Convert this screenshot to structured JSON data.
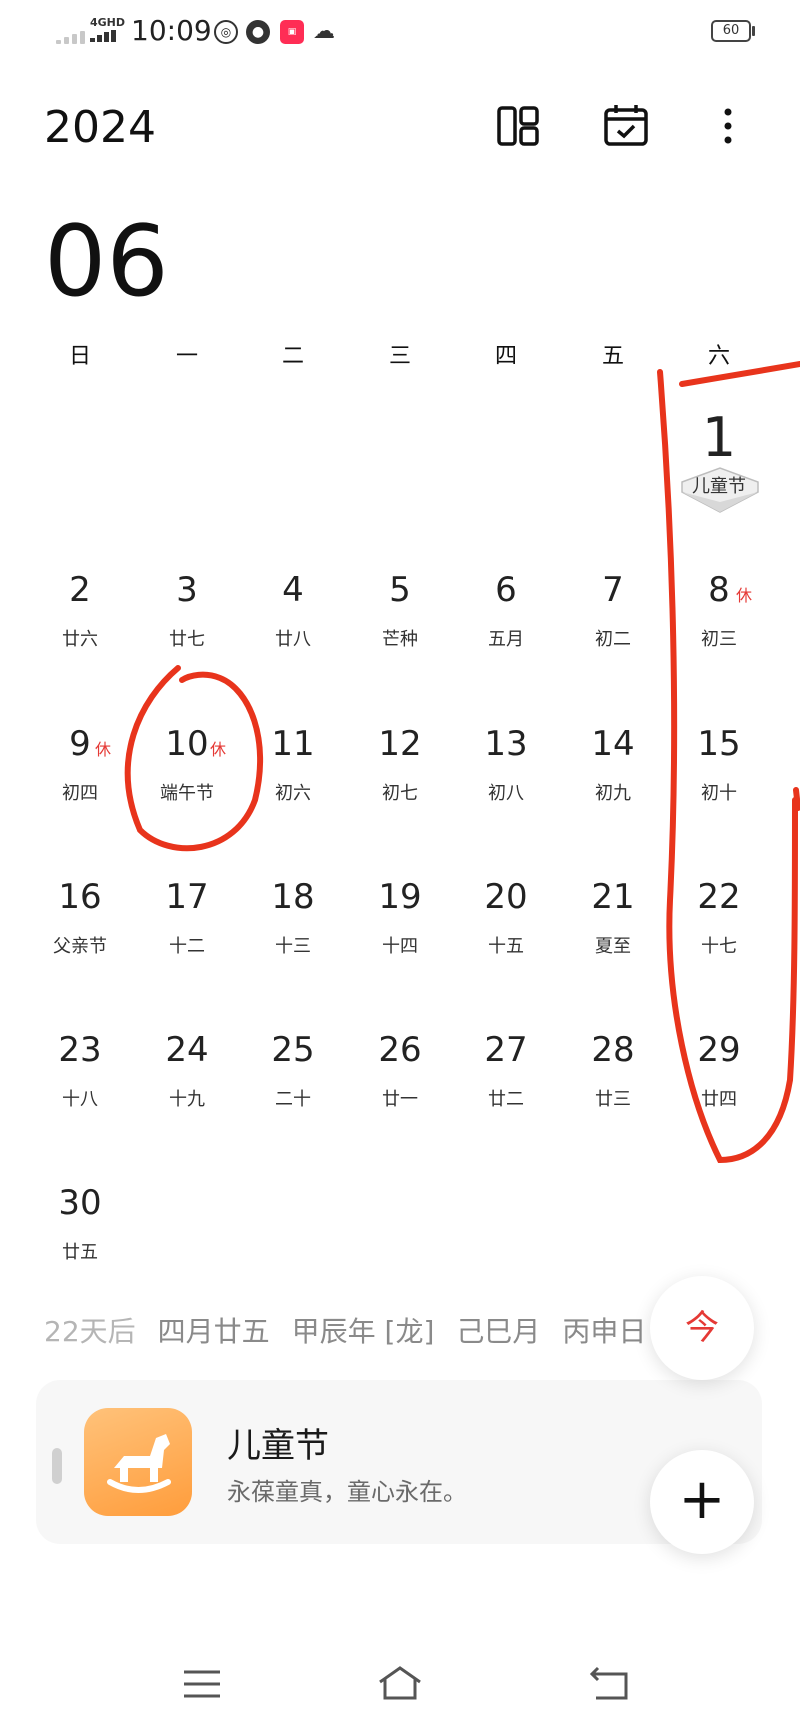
{
  "status_bar": {
    "network_label": "4GHD",
    "time": "10:09",
    "battery": "60",
    "icons": [
      "signal-icon",
      "network-icon",
      "app-icon-1",
      "app-icon-2",
      "app-icon-3",
      "cloud-icon",
      "battery-icon"
    ]
  },
  "header": {
    "year": "2024",
    "month": "06",
    "buttons": [
      "layout-icon",
      "calendar-check-icon",
      "more-icon"
    ]
  },
  "weekdays": [
    "日",
    "一",
    "二",
    "三",
    "四",
    "五",
    "六"
  ],
  "days": [
    {
      "day": "1",
      "lunar": "儿童节"
    },
    {
      "day": "2",
      "lunar": "廿六"
    },
    {
      "day": "3",
      "lunar": "廿七"
    },
    {
      "day": "4",
      "lunar": "廿八"
    },
    {
      "day": "5",
      "lunar": "芒种"
    },
    {
      "day": "6",
      "lunar": "五月"
    },
    {
      "day": "7",
      "lunar": "初二"
    },
    {
      "day": "8",
      "lunar": "初三",
      "badge": "休"
    },
    {
      "day": "9",
      "lunar": "初四",
      "badge": "休"
    },
    {
      "day": "10",
      "lunar": "端午节",
      "badge": "休"
    },
    {
      "day": "11",
      "lunar": "初六"
    },
    {
      "day": "12",
      "lunar": "初七"
    },
    {
      "day": "13",
      "lunar": "初八"
    },
    {
      "day": "14",
      "lunar": "初九"
    },
    {
      "day": "15",
      "lunar": "初十"
    },
    {
      "day": "16",
      "lunar": "父亲节"
    },
    {
      "day": "17",
      "lunar": "十二"
    },
    {
      "day": "18",
      "lunar": "十三"
    },
    {
      "day": "19",
      "lunar": "十四"
    },
    {
      "day": "20",
      "lunar": "十五"
    },
    {
      "day": "21",
      "lunar": "夏至"
    },
    {
      "day": "22",
      "lunar": "十七"
    },
    {
      "day": "23",
      "lunar": "十八"
    },
    {
      "day": "24",
      "lunar": "十九"
    },
    {
      "day": "25",
      "lunar": "二十"
    },
    {
      "day": "26",
      "lunar": "廿一"
    },
    {
      "day": "27",
      "lunar": "廿二"
    },
    {
      "day": "28",
      "lunar": "廿三"
    },
    {
      "day": "29",
      "lunar": "廿四"
    },
    {
      "day": "30",
      "lunar": "廿五"
    }
  ],
  "info": {
    "countdown": "22天后",
    "lunar_date": "四月廿五",
    "ganzhi_year": "甲辰年 [龙]",
    "ganzhi_month": "己巳月",
    "ganzhi_day_partial": "丙申日"
  },
  "event": {
    "title": "儿童节",
    "description": "永葆童真，童心永在。",
    "icon": "rocking-horse-icon"
  },
  "fab": {
    "today_label": "今",
    "add_label": "+"
  },
  "nav": [
    "menu-icon",
    "home-icon",
    "back-icon"
  ],
  "colors": {
    "holiday_red": "#e53935",
    "annotation_red": "#e8341c",
    "event_icon": "#ffad55"
  }
}
